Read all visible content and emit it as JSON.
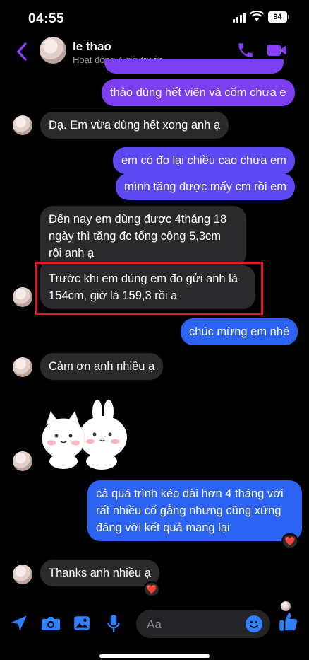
{
  "status_bar": {
    "time": "04:55",
    "battery": "94"
  },
  "header": {
    "name": "le thao",
    "status": "Hoạt động 4 giờ trước",
    "icons": [
      "back-chevron-icon",
      "phone-icon",
      "video-camera-icon"
    ]
  },
  "messages": [
    {
      "side": "out",
      "text": "thảo dùng hết viên và cốm chưa e"
    },
    {
      "side": "in",
      "text": "Dạ. Em vừa dùng hết xong anh ạ"
    },
    {
      "side": "out",
      "text": "em có đo lại chiều cao chưa em"
    },
    {
      "side": "out",
      "text": "mình tăng được mấy cm rồi em"
    },
    {
      "side": "in",
      "lines": [
        "Đến nay em dùng được 4tháng 18",
        "ngày thì tăng đc tổng cộng 5,3cm",
        "rồi anh ạ"
      ]
    },
    {
      "side": "in",
      "lines": [
        "Trước khi em dùng em đo gửi anh là",
        "154cm, giờ là 159,3 rồi a"
      ]
    },
    {
      "side": "out",
      "text": "chúc mừng em nhé"
    },
    {
      "side": "in",
      "text": "Cảm ơn anh nhiều ạ"
    },
    {
      "side": "in",
      "sticker": "cat-and-bunny-sticker"
    },
    {
      "side": "out",
      "lines": [
        "cả quá trình kéo dài hơn 4 tháng với",
        "rất nhiều cố gắng nhưng cũng xứng",
        "đáng với kết quả mang lại"
      ],
      "reaction": "❤️"
    },
    {
      "side": "in",
      "text": "Thanks anh nhiều ạ",
      "reaction": "❤️"
    }
  ],
  "composer": {
    "placeholder": "Aa",
    "icons": [
      "location-arrow-icon",
      "camera-icon",
      "image-icon",
      "microphone-icon",
      "emoji-icon",
      "thumbs-up-icon"
    ]
  },
  "colors": {
    "outgoing_top": "#7b3ff0",
    "outgoing_mid": "#5c49f2",
    "outgoing_bottom": "#2d63f2",
    "incoming": "#2a2a2c",
    "accent": "#8a3ffc",
    "highlight_box": "#e01b1b"
  }
}
